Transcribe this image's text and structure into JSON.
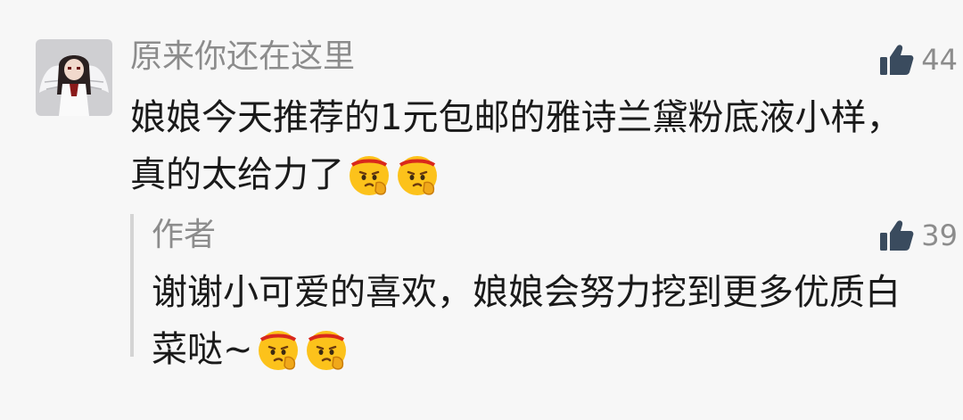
{
  "comment": {
    "username": "原来你还在这里",
    "like_count": "44",
    "text": "娘娘今天推荐的1元包邮的雅诗兰黛粉底液小样，真的太给力了",
    "emojis": [
      "saluting-face-emoji",
      "saluting-face-emoji"
    ]
  },
  "reply": {
    "author": "作者",
    "like_count": "39",
    "text": "谢谢小可爱的喜欢，娘娘会努力挖到更多优质白菜哒~",
    "emojis": [
      "saluting-face-emoji",
      "saluting-face-emoji"
    ]
  },
  "icons": {
    "like": "thumbs-up-icon",
    "avatar": "anime-angel-avatar"
  },
  "colors": {
    "background": "#f7f7f7",
    "username": "#8c8c8c",
    "text": "#1a1a1a",
    "like_icon": "#3a4b5e",
    "reply_border": "#d4d4d4"
  }
}
